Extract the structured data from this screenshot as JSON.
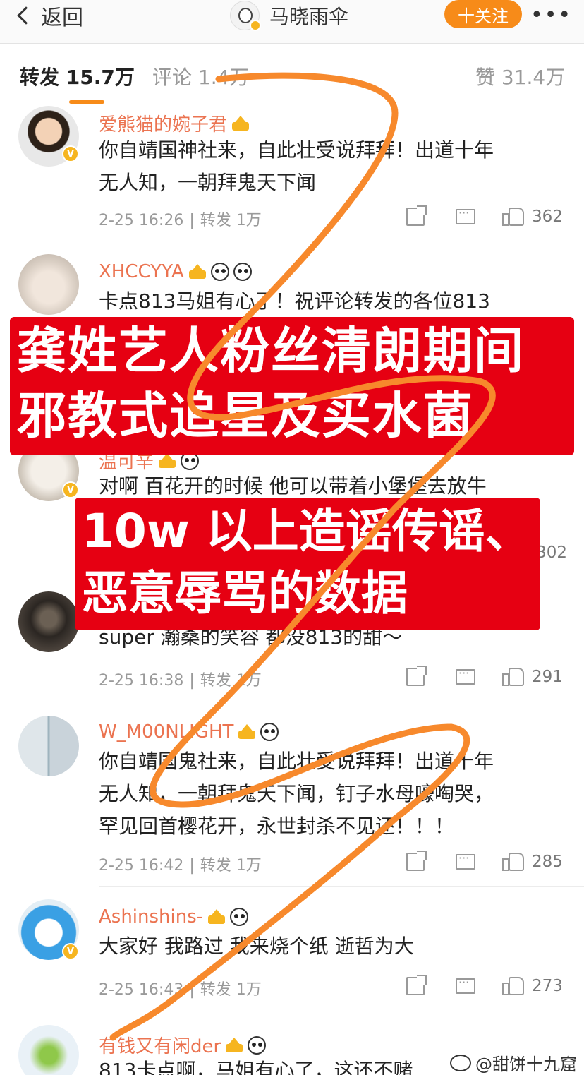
{
  "header": {
    "back_label": "返回",
    "title": "马晓雨伞",
    "follow_label": "十关注",
    "more_label": "•••"
  },
  "tabs": {
    "repost": "转发 15.7万",
    "comments": "评论 1.4万",
    "likes": "赞 31.4万"
  },
  "comments": [
    {
      "name": "爱熊猫的婉子君",
      "lines": [
        "你自靖国神社来，自此壮受说拜拜！出道十年",
        "无人知，一朝拜鬼天下闻"
      ],
      "time": "2-25 16:26",
      "reposts": "转发 1万",
      "likes": "362"
    },
    {
      "name": "XHCCYYA",
      "lines": [
        "卡点813马姐有心了！祝评论转发的各位813"
      ]
    },
    {
      "name": "温可辛",
      "lines": [
        "对啊 百花开的时候 他可以带着小堡堡去放牛"
      ],
      "likes": "302"
    },
    {
      "name": "",
      "lines": [
        "super 瀚桑的笑容 都没813的甜～"
      ],
      "time": "2-25 16:38",
      "reposts": "转发 1万",
      "likes": "291"
    },
    {
      "name": "W_M00NLIGHT",
      "lines": [
        "你自靖国鬼社来，自此壮受说拜拜！出道十年",
        "无人知，一朝拜鬼天下闻，钉子水母嚎啕哭，",
        "罕见回首樱花开，永世封杀不见还！！！"
      ],
      "time": "2-25 16:42",
      "reposts": "转发 1万",
      "likes": "285"
    },
    {
      "name": "Ashinshins-",
      "lines": [
        "大家好 我路过 我来烧个纸 逝哲为大"
      ],
      "time": "2-25 16:43",
      "reposts": "转发 1万",
      "likes": "273"
    },
    {
      "name": "有钱又有闲der",
      "lines": [
        "813卡点啊，马姐有心了，这还不赌"
      ]
    }
  ],
  "overlays": {
    "banner1": [
      "龚姓艺人粉丝清朗期间",
      "邪教式追星及买水菌"
    ],
    "banner2": [
      "10w 以上造谣传谣、",
      "恶意辱骂的数据"
    ],
    "watermark": "@甜饼十九窟"
  },
  "colors": {
    "accent": "#f78b19",
    "username": "#eb7350",
    "banner": "#e60012",
    "scribble": "#f7892c"
  }
}
